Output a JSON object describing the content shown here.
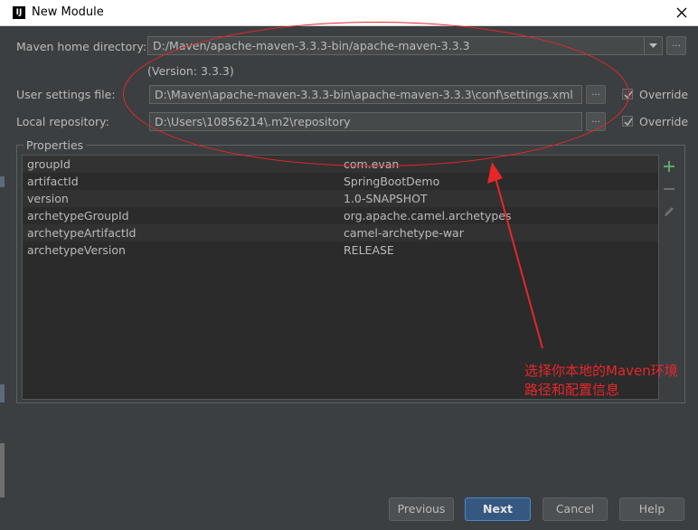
{
  "window": {
    "title": "New Module",
    "app_icon_text": "IJ"
  },
  "maven": {
    "home_label": "Maven home directory:",
    "home_value": "D:/Maven/apache-maven-3.3.3-bin/apache-maven-3.3.3",
    "version_text": "(Version: 3.3.3)",
    "settings_label": "User settings file:",
    "settings_value": "D:\\Maven\\apache-maven-3.3.3-bin\\apache-maven-3.3.3\\conf\\settings.xml",
    "repo_label": "Local repository:",
    "repo_value": "D:\\Users\\10856214\\.m2\\repository",
    "override_label": "Override",
    "browse_label": "..."
  },
  "properties": {
    "title": "Properties",
    "rows": [
      {
        "key": "groupId",
        "value": "com.evan"
      },
      {
        "key": "artifactId",
        "value": "SpringBootDemo"
      },
      {
        "key": "version",
        "value": "1.0-SNAPSHOT"
      },
      {
        "key": "archetypeGroupId",
        "value": "org.apache.camel.archetypes"
      },
      {
        "key": "archetypeArtifactId",
        "value": "camel-archetype-war"
      },
      {
        "key": "archetypeVersion",
        "value": "RELEASE"
      }
    ]
  },
  "buttons": {
    "previous": "Previous",
    "next": "Next",
    "cancel": "Cancel",
    "help": "Help"
  },
  "annotation": {
    "line1": "选择你本地的Maven环境",
    "line2": "路径和配置信息",
    "color": "#e8262a"
  },
  "colors": {
    "background": "#3c3f41",
    "add_icon": "#59a869"
  },
  "icons": [
    "close-icon",
    "chevron-down-icon",
    "add-icon",
    "remove-icon",
    "edit-icon",
    "checkmark-icon",
    "arrow-icon"
  ]
}
